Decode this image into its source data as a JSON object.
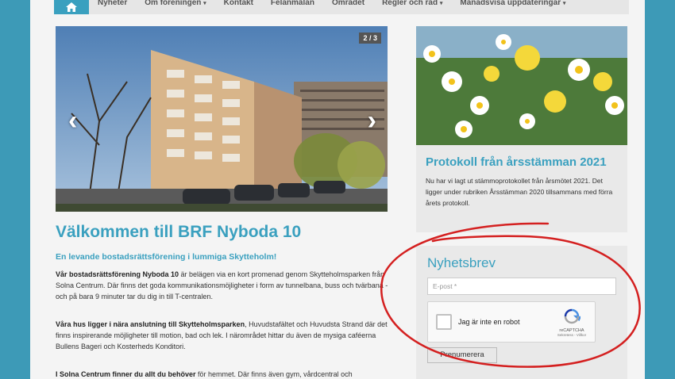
{
  "nav": {
    "items": [
      "Nyheter",
      "Om föreningen",
      "Kontakt",
      "Felanmälan",
      "Området",
      "Regler och råd",
      "Månadsvisa uppdateringar"
    ],
    "dropdown_flags": [
      false,
      true,
      false,
      false,
      false,
      true,
      true
    ]
  },
  "slider": {
    "counter": "2 / 3"
  },
  "main": {
    "title": "Välkommen till BRF Nyboda 10",
    "subtitle": "En levande bostadsrättsförening i lummiga Skytteholm!",
    "p1_bold": "Vår bostadsrättsförening Nyboda 10",
    "p1_text": " är belägen via en kort promenad genom Skytteholmsparken från Solna Centrum. Där finns det goda kommunikationsmöjligheter i form av tunnelbana, buss och tvärbana - och på bara 9 minuter tar du dig in till T-centralen.",
    "p2_bold": "Våra hus ligger i nära anslutning till Skytteholmsparken",
    "p2_text": ", Huvudstafältet och Huvudsta Strand där det finns inspirerande möjligheter till motion, bad och lek. I närområdet hittar du även de mysiga caféerna Bullens Bageri och Kosterheds Konditori.",
    "p3_bold": "I Solna Centrum finner du allt du behöver",
    "p3_text": " för hemmet. Där finns även gym, vårdcentral och"
  },
  "protokoll": {
    "title": "Protokoll från årsstämman 2021",
    "text": "Nu har vi lagt ut stämmoprotokollet från årsmötet 2021. Det ligger under rubriken Årsstämman 2020 tillsammans med förra årets protokoll."
  },
  "newsletter": {
    "title": "Nyhetsbrev",
    "email_placeholder": "E-post *",
    "captcha_label": "Jag är inte en robot",
    "captcha_brand": "reCAPTCHA",
    "captcha_links": "Sekretess - Villkor",
    "subscribe_label": "Prenumerera"
  },
  "colors": {
    "accent": "#3aa0bf",
    "annotation": "#d42020"
  }
}
